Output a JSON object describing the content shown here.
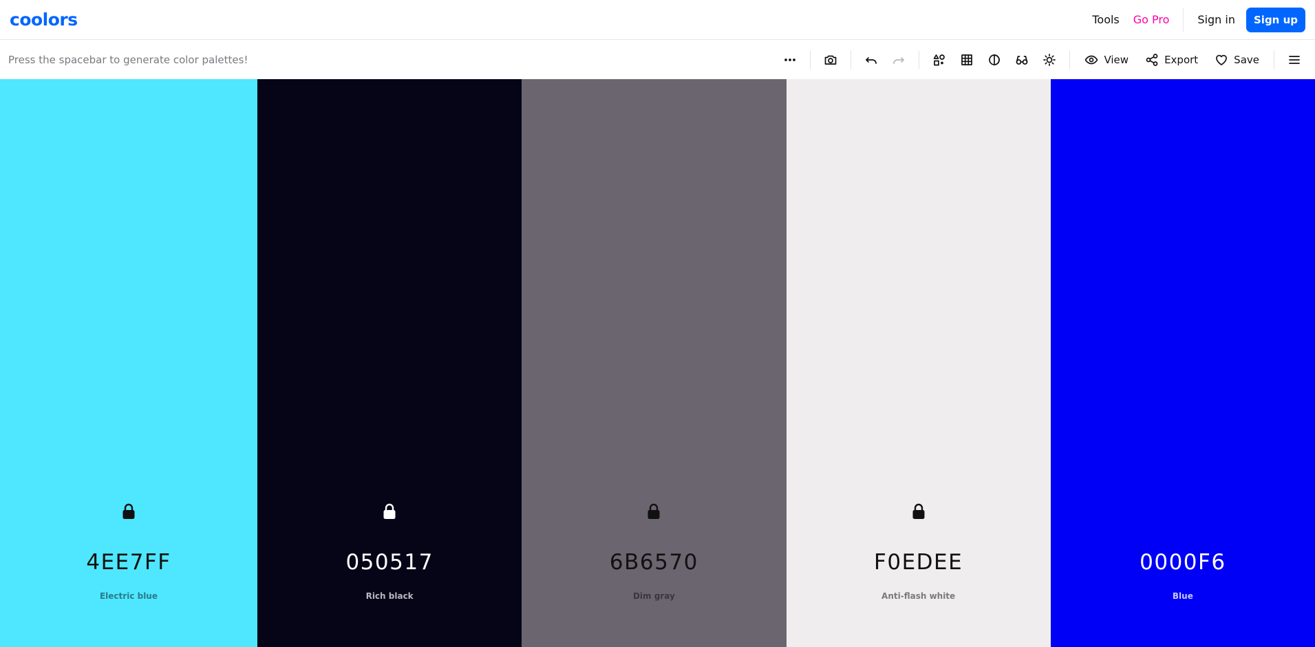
{
  "header": {
    "logo_text": "coolors",
    "nav": {
      "tools_label": "Tools",
      "gopro_label": "Go Pro",
      "signin_label": "Sign in",
      "signup_label": "Sign up"
    },
    "colors": {
      "brand": "#0066ff",
      "pro": "#ff00a8"
    }
  },
  "toolbar": {
    "hint": "Press the spacebar to generate color palettes!",
    "icons": [
      "more-icon",
      "camera-icon",
      "undo-icon",
      "redo-icon",
      "shapes-icon",
      "grid-icon",
      "contrast-icon",
      "glasses-icon",
      "sun-icon"
    ],
    "view_label": "View",
    "export_label": "Export",
    "save_label": "Save"
  },
  "palette": [
    {
      "hex": "4EE7FF",
      "name": "Electric blue",
      "bg": "#4EE7FF",
      "fg": "#111111",
      "sub": "#2a7a88"
    },
    {
      "hex": "050517",
      "name": "Rich black",
      "bg": "#050517",
      "fg": "#ffffff",
      "sub": "#b8b8c0"
    },
    {
      "hex": "6B6570",
      "name": "Dim gray",
      "bg": "#6B6570",
      "fg": "#111111",
      "sub": "#3a363d"
    },
    {
      "hex": "F0EDEE",
      "name": "Anti-flash white",
      "bg": "#F0EDEE",
      "fg": "#111111",
      "sub": "#7b797a"
    },
    {
      "hex": "0000F6",
      "name": "Blue",
      "bg": "#0000F6",
      "fg": "#ffffff",
      "sub": "#c8c8ff"
    }
  ]
}
